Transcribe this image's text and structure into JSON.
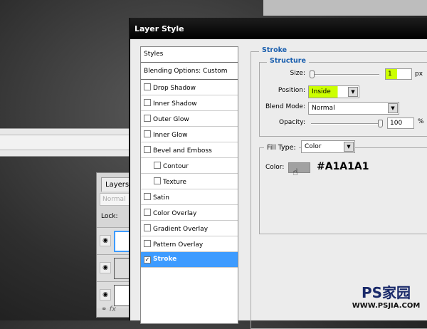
{
  "dialog": {
    "title": "Layer Style"
  },
  "styles_list": {
    "header": "Styles",
    "blending": "Blending Options: Custom",
    "items": [
      {
        "label": "Drop Shadow",
        "checked": false,
        "indent": false
      },
      {
        "label": "Inner Shadow",
        "checked": false,
        "indent": false
      },
      {
        "label": "Outer Glow",
        "checked": false,
        "indent": false
      },
      {
        "label": "Inner Glow",
        "checked": false,
        "indent": false
      },
      {
        "label": "Bevel and Emboss",
        "checked": false,
        "indent": false
      },
      {
        "label": "Contour",
        "checked": false,
        "indent": true
      },
      {
        "label": "Texture",
        "checked": false,
        "indent": true
      },
      {
        "label": "Satin",
        "checked": false,
        "indent": false
      },
      {
        "label": "Color Overlay",
        "checked": false,
        "indent": false
      },
      {
        "label": "Gradient Overlay",
        "checked": false,
        "indent": false
      },
      {
        "label": "Pattern Overlay",
        "checked": false,
        "indent": false
      },
      {
        "label": "Stroke",
        "checked": true,
        "indent": false,
        "selected": true
      }
    ]
  },
  "stroke": {
    "title": "Stroke",
    "structure": "Structure",
    "size_label": "Size:",
    "size_value": "1",
    "size_unit": "px",
    "size_fraction": 0.0,
    "position_label": "Position:",
    "position_value": "Inside",
    "blend_label": "Blend Mode:",
    "blend_value": "Normal",
    "opacity_label": "Opacity:",
    "opacity_value": "100",
    "opacity_unit": "%",
    "fill_type_label": "Fill Type:",
    "fill_type_value": "Color",
    "color_label": "Color:",
    "color_hex": "#A1A1A1",
    "color_swatch": "#a1a1a1"
  },
  "layers_panel": {
    "tab": "Layers",
    "mode": "Normal",
    "lock": "Lock:",
    "footer": "fx"
  },
  "watermark": {
    "logo": "PS家园",
    "url": "WWW.PSJIA.COM"
  },
  "colors": {
    "selection": "#3d9bff",
    "highlight": "#ccff00",
    "heading": "#1b5fae"
  }
}
